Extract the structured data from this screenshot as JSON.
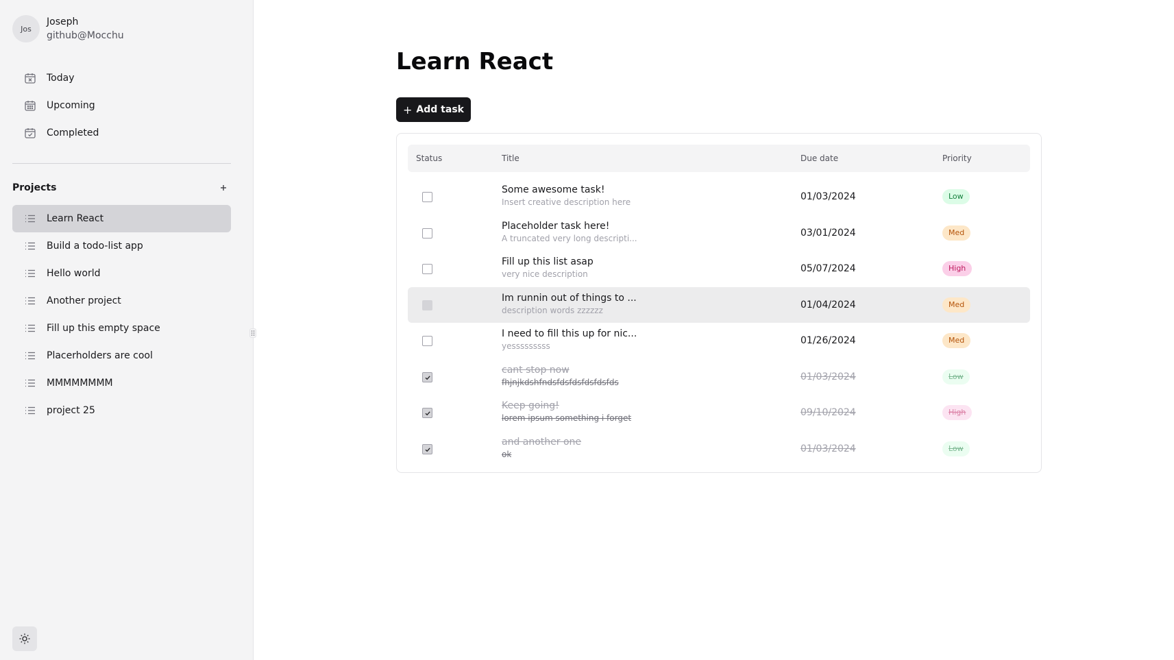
{
  "user": {
    "initials": "Jos",
    "name": "Joseph",
    "handle": "github@Mocchu"
  },
  "nav": [
    {
      "label": "Today",
      "icon": "calendar-x-icon"
    },
    {
      "label": "Upcoming",
      "icon": "calendar-days-icon"
    },
    {
      "label": "Completed",
      "icon": "calendar-check-icon"
    }
  ],
  "projects": {
    "title": "Projects",
    "add_icon": "plus-icon",
    "items": [
      {
        "label": "Learn React",
        "active": true
      },
      {
        "label": "Build a todo-list app"
      },
      {
        "label": "Hello world"
      },
      {
        "label": "Another project"
      },
      {
        "label": "Fill up this empty space"
      },
      {
        "label": "Placerholders are cool"
      },
      {
        "label": "MMMMMMMM"
      },
      {
        "label": "project 25"
      }
    ]
  },
  "main": {
    "title": "Learn React",
    "add_task_label": "Add task"
  },
  "table": {
    "headers": {
      "status": "Status",
      "title": "Title",
      "due": "Due date",
      "priority": "Priority"
    },
    "rows": [
      {
        "title": "Some awesome task!",
        "description": "Insert creative description here",
        "due": "01/03/2024",
        "priority": "Low",
        "completed": false
      },
      {
        "title": "Placeholder task here!",
        "description": "A truncated very long descripti...",
        "due": "03/01/2024",
        "priority": "Med",
        "completed": false
      },
      {
        "title": "Fill up this list asap",
        "description": "very nice description",
        "due": "05/07/2024",
        "priority": "High",
        "completed": false
      },
      {
        "title": "Im runnin out of things to ...",
        "description": "description words zzzzzz",
        "due": "01/04/2024",
        "priority": "Med",
        "completed": false,
        "hovered": true
      },
      {
        "title": "I need to fill this up for nic...",
        "description": "yesssssssss",
        "due": "01/26/2024",
        "priority": "Med",
        "completed": false
      },
      {
        "title": "cant stop now",
        "description": "fhjnjkdshfndsfdsfdsfdsfdsfds",
        "due": "01/03/2024",
        "priority": "Low",
        "completed": true
      },
      {
        "title": "Keep going!",
        "description": "lorem ipsum something i forget",
        "due": "09/10/2024",
        "priority": "High",
        "completed": true
      },
      {
        "title": "and another one",
        "description": "ok",
        "due": "01/03/2024",
        "priority": "Low",
        "completed": true
      }
    ]
  },
  "colors": {
    "sidebar_bg": "#f4f4f5",
    "active_item": "#d4d4d8",
    "primary_button": "#18181b",
    "low": "#dcfce7",
    "med": "#fde7c8",
    "high": "#fbcfe8"
  }
}
